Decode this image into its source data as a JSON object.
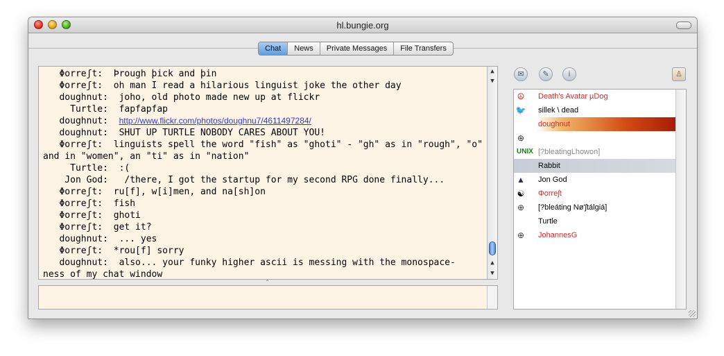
{
  "window": {
    "title": "hl.bungie.org"
  },
  "tabs": [
    {
      "label": "Chat",
      "active": true
    },
    {
      "label": "News",
      "active": false
    },
    {
      "label": "Private Messages",
      "active": false
    },
    {
      "label": "File Transfers",
      "active": false
    }
  ],
  "chat": {
    "lines": [
      {
        "text": "   Φorreʃt:  Þrough þick and þin"
      },
      {
        "text": "   Φorreʃt:  oh man I read a hilarious linguist joke the other day"
      },
      {
        "text": "   doughnut:  joho, old photo made new up at flickr"
      },
      {
        "text": "     Turtle:  fapfapfap"
      },
      {
        "prefix": "   doughnut:  ",
        "link": "http://www.flickr.com/photos/doughnu7/4611497284/"
      },
      {
        "text": "   doughnut:  SHUT UP TURTLE NOBODY CARES ABOUT YOU!"
      },
      {
        "text": "   Φorreʃt:  linguists spell the word \"fish\" as \"ghoti\" - \"gh\" as in \"rough\", \"o\""
      },
      {
        "text": "and in \"women\", an \"ti\" as in \"nation\""
      },
      {
        "text": "     Turtle:  :("
      },
      {
        "text": "    Jon God:   /there, I got the startup for my second RPG done finally..."
      },
      {
        "text": "   Φorreʃt:  ru[f], w[i]men, and na[sh]on"
      },
      {
        "text": "   Φorreʃt:  fish"
      },
      {
        "text": "   Φorreʃt:  ghoti"
      },
      {
        "text": "   Φorreʃt:  get it?"
      },
      {
        "text": "   doughnut:  ... yes"
      },
      {
        "text": "   Φorreʃt:  *rou[f] sorry"
      },
      {
        "text": "   doughnut:  also... your funky higher ascii is messing with the monospace-"
      },
      {
        "text": "ness of my chat window"
      }
    ],
    "input_value": ""
  },
  "user_buttons": [
    {
      "icon": "private-message-icon"
    },
    {
      "icon": "chat-bubble-icon"
    },
    {
      "icon": "info-icon"
    },
    {
      "icon": "user-admin-icon"
    }
  ],
  "users": [
    {
      "name": "Death's Avatar µDog",
      "color": "#e02424",
      "icon": "grateful-dead-icon",
      "banner": false,
      "selected": false
    },
    {
      "name": "sillek \\ dead",
      "color": "#000000",
      "icon": "bird-icon",
      "banner": false,
      "selected": false
    },
    {
      "name": "doughnut",
      "color": "#e02424",
      "icon": "",
      "banner": true,
      "selected": false
    },
    {
      "name": "",
      "color": "#000000",
      "icon": "globe-icon",
      "banner": false,
      "selected": false
    },
    {
      "name": "[?bleatingLhowon]",
      "color": "#8a8a8a",
      "icon": "unix-icon",
      "banner": false,
      "selected": false
    },
    {
      "name": "Rabbit",
      "color": "#000000",
      "icon": "",
      "banner": false,
      "selected": true
    },
    {
      "name": "Jon God",
      "color": "#000000",
      "icon": "wizard-icon",
      "banner": false,
      "selected": false
    },
    {
      "name": "Φorreʃt",
      "color": "#e02424",
      "icon": "yin-yang-icon",
      "banner": false,
      "selected": false
    },
    {
      "name": "[?bleáting Nø'ʃtálgiá]",
      "color": "#000000",
      "icon": "globe-icon",
      "banner": false,
      "selected": false
    },
    {
      "name": "Turtle",
      "color": "#000000",
      "icon": "",
      "banner": false,
      "selected": false
    },
    {
      "name": "JohannesG",
      "color": "#e02424",
      "icon": "globe-icon",
      "banner": false,
      "selected": false
    }
  ]
}
